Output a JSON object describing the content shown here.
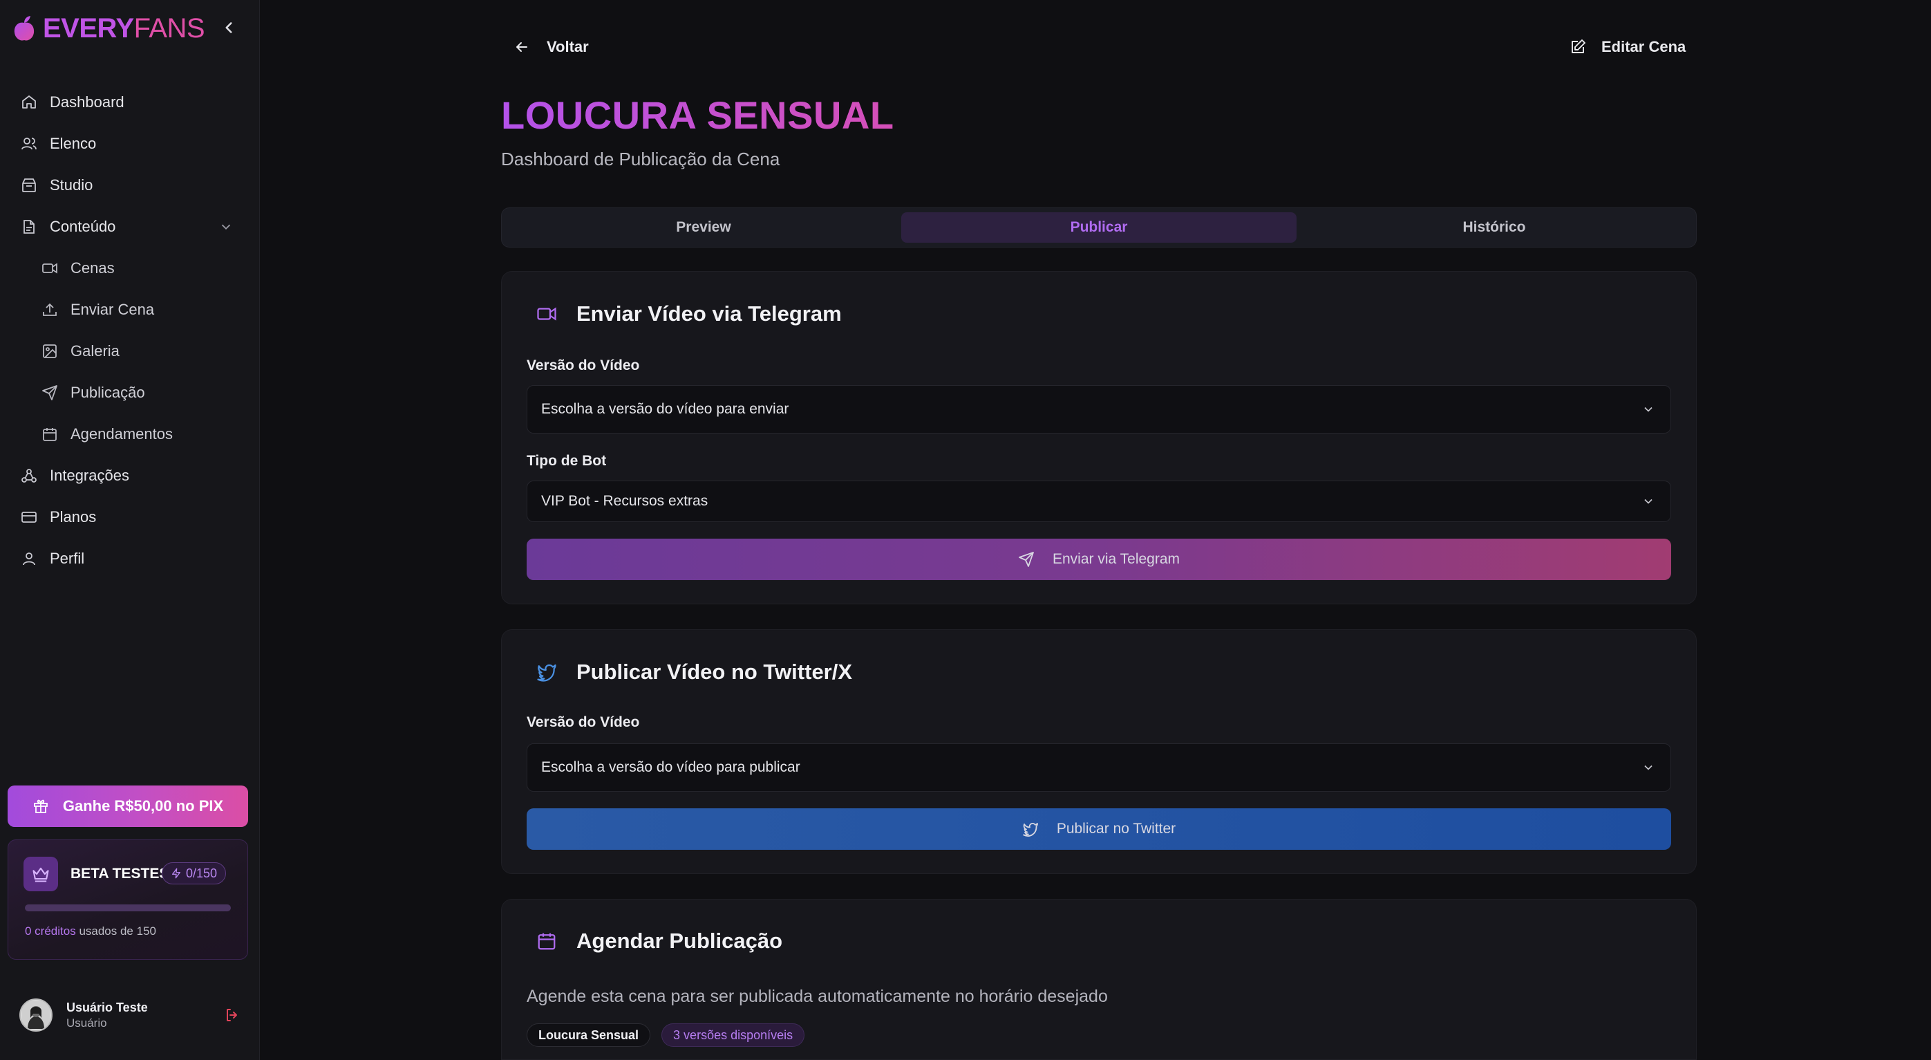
{
  "brand": {
    "every": "EVERY",
    "fans": "FANS"
  },
  "sidebar": {
    "items": [
      {
        "label": "Dashboard",
        "icon": "home-icon"
      },
      {
        "label": "Elenco",
        "icon": "users-icon"
      },
      {
        "label": "Studio",
        "icon": "studio-icon"
      },
      {
        "label": "Conteúdo",
        "icon": "file-icon"
      },
      {
        "label": "Cenas",
        "icon": "video-icon"
      },
      {
        "label": "Enviar Cena",
        "icon": "upload-icon"
      },
      {
        "label": "Galeria",
        "icon": "image-icon"
      },
      {
        "label": "Publicação",
        "icon": "send-icon"
      },
      {
        "label": "Agendamentos",
        "icon": "calendar-icon"
      },
      {
        "label": "Integrações",
        "icon": "integrations-icon"
      },
      {
        "label": "Planos",
        "icon": "credit-card-icon"
      },
      {
        "label": "Perfil",
        "icon": "user-icon"
      }
    ],
    "promo_label": "Ganhe R$50,00 no PIX",
    "beta": {
      "title": "BETA TESTES",
      "badge": "0/150",
      "progress": 0.0,
      "credits_used": "0 créditos",
      "credits_note": "usados de 150"
    },
    "user": {
      "name": "Usuário Teste",
      "role": "Usuário"
    }
  },
  "header": {
    "back_label": "Voltar",
    "edit_label": "Editar Cena",
    "title": "LOUCURA SENSUAL",
    "subtitle": "Dashboard de Publicação da Cena"
  },
  "tabs": [
    {
      "label": "Preview",
      "active": false
    },
    {
      "label": "Publicar",
      "active": true
    },
    {
      "label": "Histórico",
      "active": false
    }
  ],
  "telegram": {
    "title": "Enviar Vídeo via Telegram",
    "version_label": "Versão do Vídeo",
    "version_placeholder": "Escolha a versão do vídeo para enviar",
    "bot_label": "Tipo de Bot",
    "bot_value": "VIP Bot - Recursos extras",
    "button_label": "Enviar via Telegram"
  },
  "twitter": {
    "title": "Publicar Vídeo no Twitter/X",
    "version_label": "Versão do Vídeo",
    "version_placeholder": "Escolha a versão do vídeo para publicar",
    "button_label": "Publicar no Twitter"
  },
  "schedule": {
    "title": "Agendar Publicação",
    "description": "Agende esta cena para ser publicada automaticamente no horário desejado",
    "chip_name": "Loucura Sensual",
    "chip_versions": "3 versões disponíveis"
  },
  "colors": {
    "accent_purple": "#b452ea",
    "accent_pink": "#d54fb8",
    "background": "#0f0f12",
    "twitter_blue": "#2a5aa6"
  }
}
